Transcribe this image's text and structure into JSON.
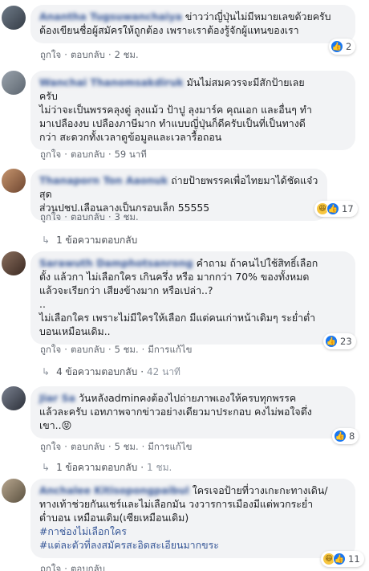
{
  "comments": [
    {
      "author": "Anantha Tugsuwanchaiya",
      "text": "ข่าวว่าญี่ปุ่นไม่มีหมายเลขด้วยครับ\nต้องเขียนชื่อผู้สมัครให้ถูกต้อง เพราะเราต้องรู้จักผู้แทนของเรา",
      "tags": [],
      "like": "ถูกใจ",
      "reply": "ตอบกลับ",
      "time": "2 ชม.",
      "edited": "",
      "react_count": "2",
      "react_icons": [
        "like"
      ],
      "replies_label": ""
    },
    {
      "author": "Wanchai Thanomsakdiruk",
      "text": "มันไม่สมควรจะมีสักป้ายเลย\nครับ\nไม่ว่าจะเป็นพรรคลุงตู่ ลุงแม้ว ป้าปู ลุงมาร์ค คุณเอก และอื่นๆ ทำ\nมาเปลืองงบ เปลืองภาษีมาก ทำแบบญี่ปุ่นก็ดีครับเป็นที่เป็นทางดี\nกว่า สะดวกทั้งเวลาดูข้อมูลและเวลารื้อถอน",
      "tags": [],
      "like": "ถูกใจ",
      "reply": "ตอบกลับ",
      "time": "59 นาที",
      "edited": "",
      "react_count": "",
      "react_icons": [],
      "replies_label": ""
    },
    {
      "author": "Thanaporn Ton Aaonuk",
      "text": "ถ่ายป้ายพรรคเพื่อไทยมาได้ชัดแจ๋วสุด\nส่วนปชป.เลือนลางเป็นกรอบเล็ก 55555",
      "tags": [],
      "like": "ถูกใจ",
      "reply": "ตอบกลับ",
      "time": "3 ชม.",
      "edited": "",
      "react_count": "17",
      "react_icons": [
        "haha",
        "like"
      ],
      "replies_label": "1 ข้อความตอบกลับ"
    },
    {
      "author": "Sarawuth Damphotsanrong",
      "text": "คำถาม ถ้าคนไปใช้สิทธิ์เลือก\nตั้ง แล้วกา ไม่เลือกใคร เกินครึ่ง หรือ มากกว่า 70% ของทั้งหมด\nแล้วจะเรียกว่า เสียงข้างมาก หรือเปล่า..?\n..\nไม่เลือกใคร เพราะไม่มีใครให้เลือก มีแต่คนเก่าหน้าเดิมๆ ระย่ำต่ำ\nบอนเหมือนเดิม..",
      "tags": [],
      "like": "ถูกใจ",
      "reply": "ตอบกลับ",
      "time": "5 ชม.",
      "edited": "มีการแก้ไข",
      "react_count": "23",
      "react_icons": [
        "like"
      ],
      "replies_label": "4 ข้อความตอบกลับ",
      "replies_time": "42 นาที"
    },
    {
      "author": "Jiar Sa",
      "text": "วันหลังadminคงต้องไปถ่ายภาพเองให้ครบทุกพรรค\nแล้วละครับ เอทภาพจากข่าวอย่างเดียวมาประกอบ คงไม่พอใจตึ่ง\nเขา..😝",
      "tags": [],
      "like": "ถูกใจ",
      "reply": "ตอบกลับ",
      "time": "5 ชม.",
      "edited": "มีการแก้ไข",
      "react_count": "8",
      "react_icons": [
        "like"
      ],
      "replies_label": "1 ข้อความตอบกลับ",
      "replies_time": "1 ชม."
    },
    {
      "author": "Anchalee Kitisopongpaibul",
      "text": "ใครเจอป้ายที่วางเกะกะทางเดิน/\nทางเท้าช่วยกันแชร์และไม่เลือกมัน วงวารการเมืองมีแต่พวกระย่ำ\nต่ำบอน เหมือนเดิม(เซียเหมือนเดิม)",
      "tags": [
        "#กาช่องไม่เลือกใคร",
        "#แต่ละตัวที่ลงสมัครสะอิดสะเอียนมากขระ"
      ],
      "like": "ถูกใจ",
      "reply": "ตอบกลับ",
      "time": "",
      "edited": "",
      "react_count": "11",
      "react_icons": [
        "haha",
        "like"
      ],
      "replies_label": ""
    }
  ]
}
